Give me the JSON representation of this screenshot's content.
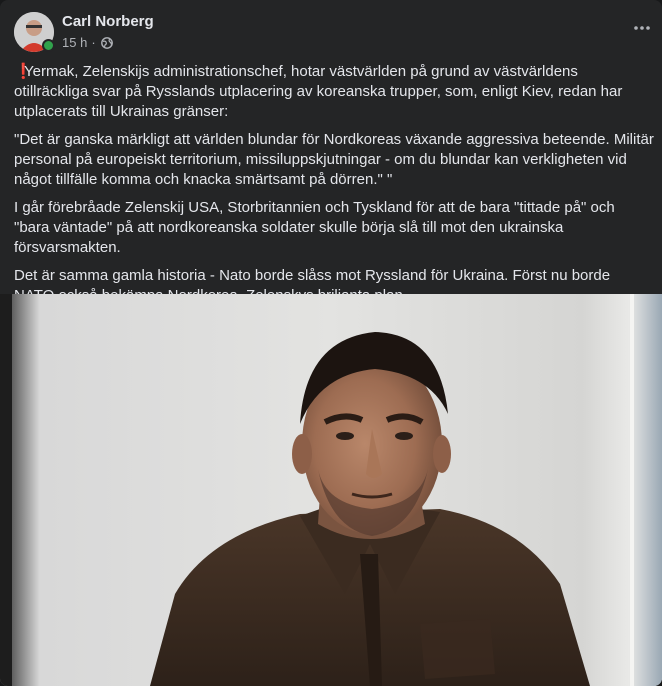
{
  "post": {
    "author_name": "Carl Norberg",
    "timestamp": "15 h",
    "separator": "·",
    "privacy_icon": "globe-icon",
    "more_icon": "more-dots-icon",
    "online_status": "online",
    "paragraphs": [
      "Yermak, Zelenskijs administrationschef, hotar västvärlden på grund av västvärldens otillräckliga svar på Rysslands utplacering av koreanska trupper, som, enligt Kiev, redan har utplacerats till Ukrainas gränser:",
      "\"Det är ganska märkligt att världen blundar för Nordkoreas växande aggressiva beteende. Militär personal på europeiskt territorium, missiluppskjutningar - om du blundar kan verkligheten vid något tillfälle komma och knacka smärtsamt på dörren.\" \"",
      "I går förebråade Zelenskij USA, Storbritannien och Tyskland för att de bara \"tittade på\" och \"bara väntade\" på att nordkoreanska soldater skulle börja slå till mot den ukrainska försvarsmakten.",
      "Det är samma gamla historia - Nato borde slåss mot Ryssland för Ukraina. Först nu borde NATO också bekämpa Nordkorea. Zelenskys briljanta plan."
    ],
    "lead_emoji": "❗"
  },
  "colors": {
    "card_bg": "#242526",
    "text_primary": "#e4e6eb",
    "text_secondary": "#b0b3b8",
    "online_green": "#31a24c",
    "exclamation_red": "#e0245e"
  }
}
